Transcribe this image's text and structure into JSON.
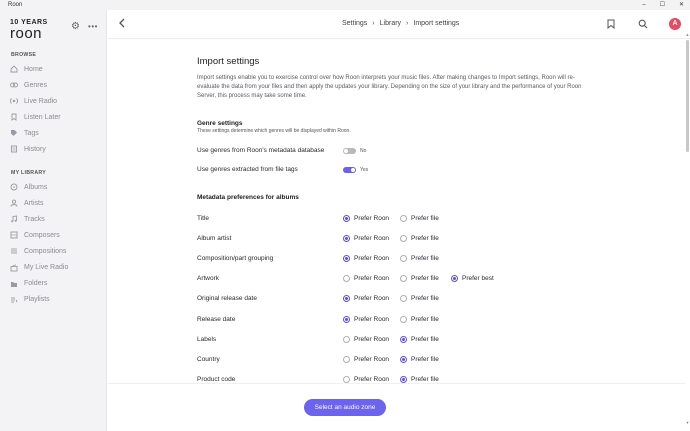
{
  "window": {
    "title": "Roon",
    "controls": [
      "–",
      "☐",
      "✕"
    ]
  },
  "sidebar": {
    "logo": {
      "line1": "10 YEARS",
      "line2": "roon"
    },
    "browse_heading": "BROWSE",
    "browse": [
      {
        "label": "Home",
        "icon": "home-icon"
      },
      {
        "label": "Genres",
        "icon": "genres-icon"
      },
      {
        "label": "Live Radio",
        "icon": "radio-icon"
      },
      {
        "label": "Listen Later",
        "icon": "bookmark-icon"
      },
      {
        "label": "Tags",
        "icon": "tag-icon"
      },
      {
        "label": "History",
        "icon": "history-icon"
      }
    ],
    "library_heading": "MY LIBRARY",
    "library": [
      {
        "label": "Albums",
        "icon": "albums-icon"
      },
      {
        "label": "Artists",
        "icon": "artists-icon"
      },
      {
        "label": "Tracks",
        "icon": "tracks-icon"
      },
      {
        "label": "Composers",
        "icon": "composers-icon"
      },
      {
        "label": "Compositions",
        "icon": "compositions-icon"
      },
      {
        "label": "My Live Radio",
        "icon": "my-radio-icon"
      },
      {
        "label": "Folders",
        "icon": "folder-icon"
      },
      {
        "label": "Playlists",
        "icon": "playlists-icon"
      }
    ]
  },
  "header": {
    "breadcrumb": [
      "Settings",
      "Library",
      "Import settings"
    ],
    "avatar_initial": "A"
  },
  "page": {
    "title": "Import settings",
    "intro": "Import settings enable you to exercise control over how Roon interprets your music files. After making changes to Import settings, Roon will re-evaluate the data from your files and then apply the updates your library. Depending on the size of your library and the performance of your Roon Server, this process may take some time.",
    "genre": {
      "heading": "Genre settings",
      "subheading": "These settings determine which genres will be displayed within Roon.",
      "rows": [
        {
          "label": "Use genres from Roon's metadata database",
          "on": false,
          "value": "No"
        },
        {
          "label": "Use genres extracted from file tags",
          "on": true,
          "value": "Yes"
        }
      ]
    },
    "metadata": {
      "heading": "Metadata preferences for albums",
      "options": [
        "Prefer Roon",
        "Prefer file",
        "Prefer best"
      ],
      "rows": [
        {
          "label": "Title",
          "selected": "Prefer Roon",
          "has_best": false
        },
        {
          "label": "Album artist",
          "selected": "Prefer Roon",
          "has_best": false
        },
        {
          "label": "Composition/part grouping",
          "selected": "Prefer Roon",
          "has_best": false
        },
        {
          "label": "Artwork",
          "selected": "Prefer best",
          "has_best": true
        },
        {
          "label": "Original release date",
          "selected": "Prefer Roon",
          "has_best": false
        },
        {
          "label": "Release date",
          "selected": "Prefer Roon",
          "has_best": false
        },
        {
          "label": "Labels",
          "selected": "Prefer file",
          "has_best": false
        },
        {
          "label": "Country",
          "selected": "Prefer file",
          "has_best": false
        },
        {
          "label": "Product code",
          "selected": "Prefer file",
          "has_best": false
        }
      ]
    }
  },
  "footer": {
    "zone_button": "Select an audio zone"
  },
  "colors": {
    "accent": "#6c63ee",
    "avatar": "#e84a5f",
    "sidebar_bg": "#f3f3f5"
  }
}
